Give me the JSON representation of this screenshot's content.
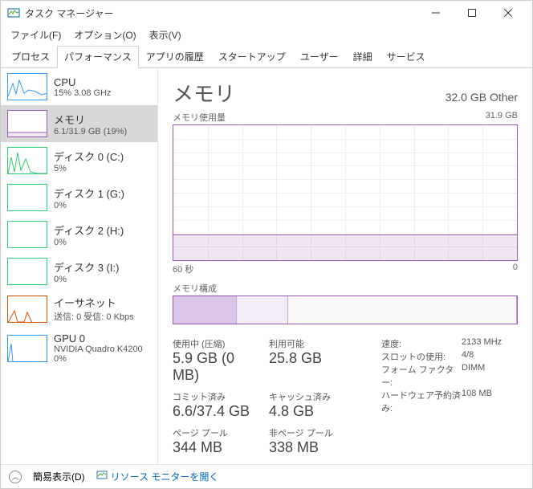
{
  "window": {
    "title": "タスク マネージャー"
  },
  "menu": {
    "file": "ファイル(F)",
    "options": "オプション(O)",
    "view": "表示(V)"
  },
  "tabs": [
    "プロセス",
    "パフォーマンス",
    "アプリの履歴",
    "スタートアップ",
    "ユーザー",
    "詳細",
    "サービス"
  ],
  "active_tab": 1,
  "sidebar": [
    {
      "name": "CPU",
      "sub": "15%  3.08 GHz",
      "color": "#3399ff"
    },
    {
      "name": "メモリ",
      "sub": "6.1/31.9 GB (19%)",
      "color": "#9b59b6",
      "selected": true
    },
    {
      "name": "ディスク 0 (C:)",
      "sub": "5%",
      "color": "#2ecc71"
    },
    {
      "name": "ディスク 1 (G:)",
      "sub": "0%",
      "color": "#2ecc71"
    },
    {
      "name": "ディスク 2 (H:)",
      "sub": "0%",
      "color": "#2ecc71"
    },
    {
      "name": "ディスク 3 (I:)",
      "sub": "0%",
      "color": "#2ecc71"
    },
    {
      "name": "イーサネット",
      "sub": "送信: 0 受信: 0 Kbps",
      "color": "#d35400"
    },
    {
      "name": "GPU 0",
      "sub": "NVIDIA Quadro K4200\n0%",
      "color": "#3399ff"
    }
  ],
  "main": {
    "title": "メモリ",
    "capacity": "32.0 GB Other",
    "usage_label": "メモリ使用量",
    "usage_max": "31.9 GB",
    "axis_left": "60 秒",
    "axis_right": "0",
    "comp_label": "メモリ構成",
    "stats": {
      "in_use_label": "使用中 (圧縮)",
      "in_use": "5.9 GB (0 MB)",
      "avail_label": "利用可能",
      "avail": "25.8 GB",
      "commit_label": "コミット済み",
      "commit": "6.6/37.4 GB",
      "cached_label": "キャッシュ済み",
      "cached": "4.8 GB",
      "paged_label": "ページ プール",
      "paged": "344 MB",
      "nonpaged_label": "非ページ プール",
      "nonpaged": "338 MB"
    },
    "specs": {
      "speed_k": "速度:",
      "speed_v": "2133 MHz",
      "slots_k": "スロットの使用:",
      "slots_v": "4/8",
      "form_k": "フォーム ファクター:",
      "form_v": "DIMM",
      "hw_k": "ハードウェア予約済み:",
      "hw_v": "108 MB"
    }
  },
  "status": {
    "fewer": "簡易表示(D)",
    "resmon": "リソース モニターを開く"
  },
  "chart_data": {
    "type": "area",
    "title": "メモリ使用量",
    "ylabel": "GB",
    "ylim": [
      0,
      31.9
    ],
    "x_range_seconds": [
      60,
      0
    ],
    "usage_percent": 19,
    "composition_segments_percent": [
      18.5,
      15,
      66.5
    ]
  }
}
